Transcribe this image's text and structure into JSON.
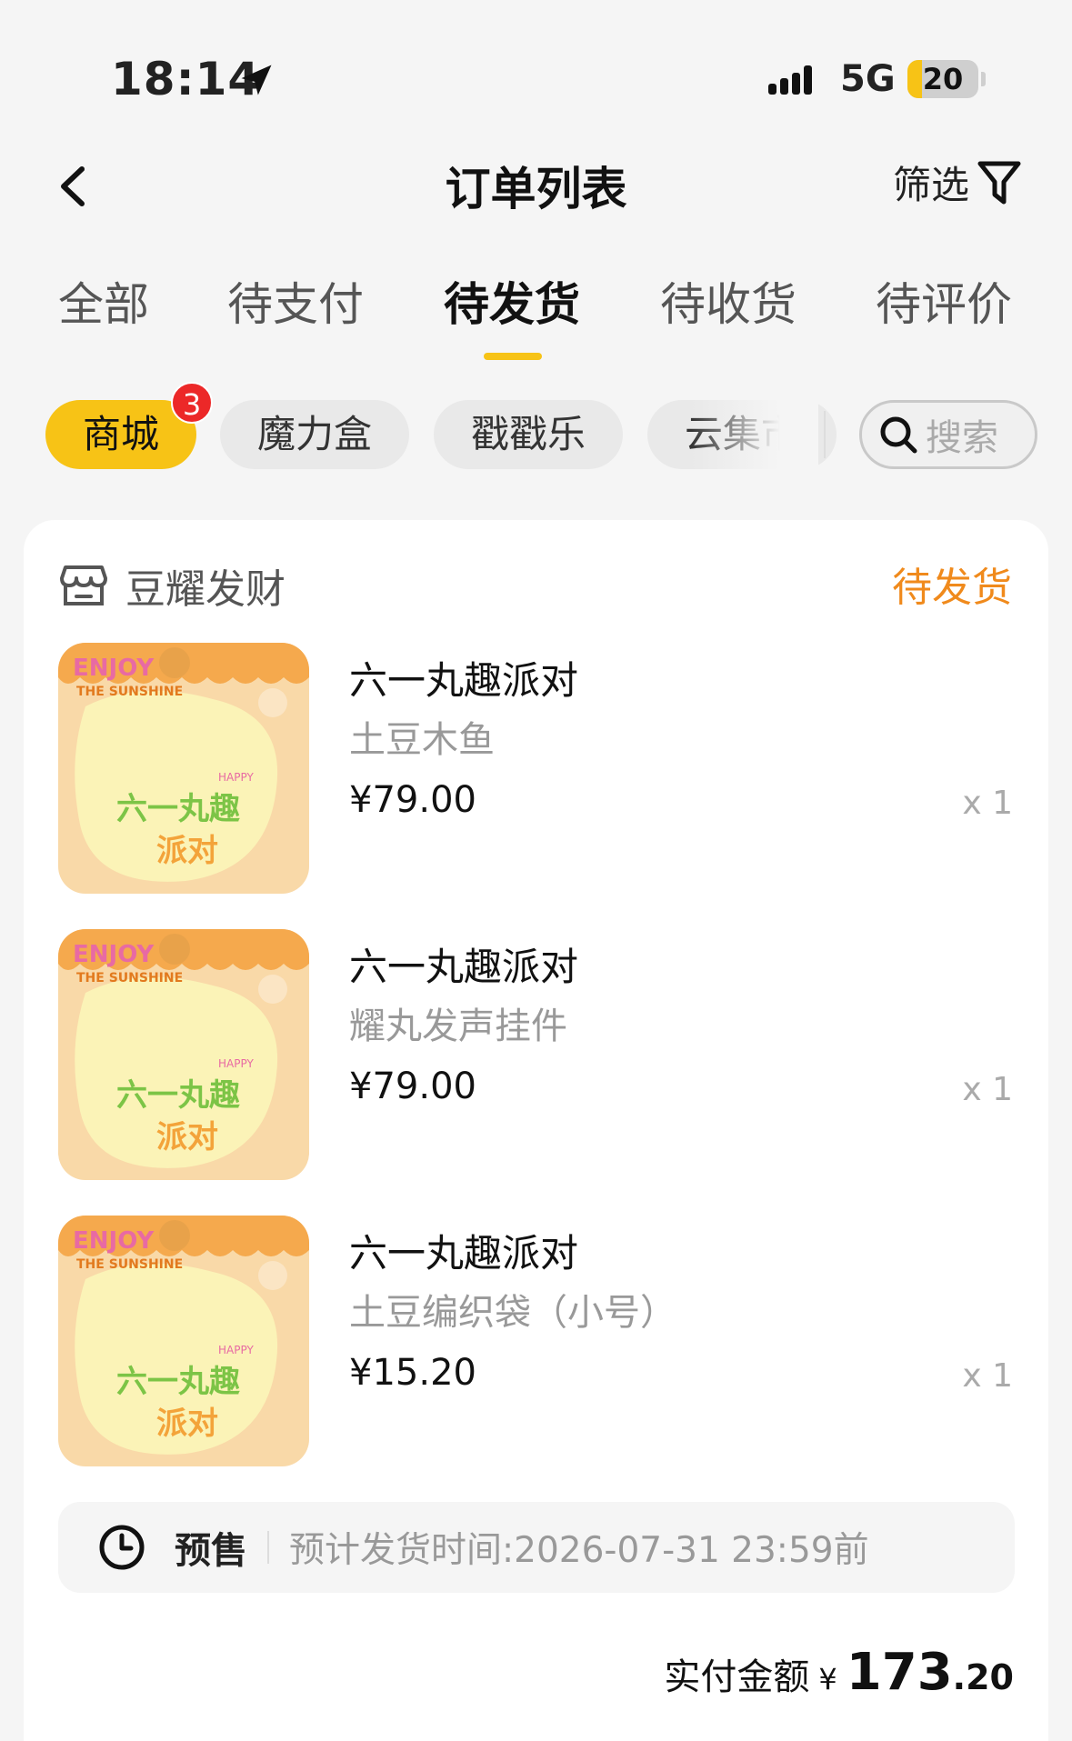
{
  "status_bar": {
    "time": "18:14",
    "network": "5G",
    "battery": "20",
    "battery_level": 0.2
  },
  "nav": {
    "title": "订单列表",
    "filter_label": "筛选"
  },
  "tabs": [
    {
      "label": "全部",
      "active": false
    },
    {
      "label": "待支付",
      "active": false
    },
    {
      "label": "待发货",
      "active": true
    },
    {
      "label": "待收货",
      "active": false
    },
    {
      "label": "待评价",
      "active": false
    }
  ],
  "chips": [
    {
      "label": "商城",
      "active": true,
      "badge": "3"
    },
    {
      "label": "魔力盒",
      "active": false
    },
    {
      "label": "戳戳乐",
      "active": false
    },
    {
      "label": "云集市",
      "active": false
    }
  ],
  "search": {
    "placeholder": "搜索"
  },
  "order": {
    "shop_name": "豆耀发财",
    "status": "待发货",
    "items": [
      {
        "title": "六一丸趣派对",
        "variant": "土豆木鱼",
        "price": "¥79.00",
        "qty": "x 1"
      },
      {
        "title": "六一丸趣派对",
        "variant": "耀丸发声挂件",
        "price": "¥79.00",
        "qty": "x 1"
      },
      {
        "title": "六一丸趣派对",
        "variant": "土豆编织袋（小号）",
        "price": "¥15.20",
        "qty": "x 1"
      }
    ],
    "thumb_text": {
      "enjoy": "ENJOY",
      "sunshine": "THE SUNSHINE",
      "happy": "HAPPY",
      "line1": "六一丸趣",
      "line2": "派对"
    },
    "presale": {
      "tag": "预售",
      "text": "预计发货时间:2026-07-31 23:59前"
    },
    "total": {
      "label": "实付金额",
      "currency": "¥",
      "int": "173",
      "dec": ".20"
    }
  },
  "colors": {
    "accent": "#f7c316",
    "status": "#f08a1c",
    "badge": "#ec2828"
  }
}
